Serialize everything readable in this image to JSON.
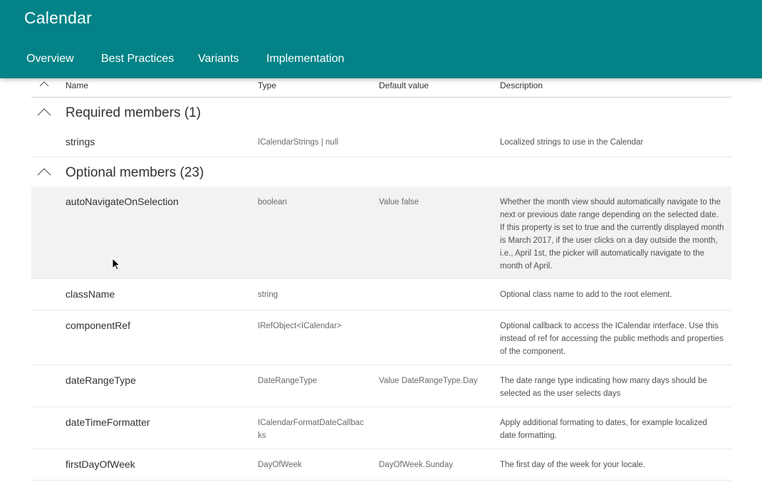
{
  "header": {
    "title": "Calendar",
    "tabs": [
      "Overview",
      "Best Practices",
      "Variants",
      "Implementation"
    ],
    "background": "#038387"
  },
  "table": {
    "columns": [
      "Name",
      "Type",
      "Default value",
      "Description"
    ],
    "groups": [
      {
        "title": "Required members (1)",
        "rows": [
          {
            "name": "strings",
            "type": "ICalendarStrings | null",
            "default": "",
            "description": "Localized strings to use in the Calendar"
          }
        ]
      },
      {
        "title": "Optional members (23)",
        "rows": [
          {
            "name": "autoNavigateOnSelection",
            "type": "boolean",
            "default": "Value false",
            "description": "Whether the month view should automatically navigate to the next or previous date range depending on the selected date. If this property is set to true and the currently displayed month is March 2017, if the user clicks on a day outside the month, i.e., April 1st, the picker will automatically navigate to the month of April."
          },
          {
            "name": "className",
            "type": "string",
            "default": "",
            "description": "Optional class name to add to the root element."
          },
          {
            "name": "componentRef",
            "type": "IRefObject<ICalendar>",
            "default": "",
            "description": "Optional callback to access the ICalendar interface. Use this instead of ref for accessing the public methods and properties of the component."
          },
          {
            "name": "dateRangeType",
            "type": "DateRangeType",
            "default": "Value DateRangeType.Day",
            "description": "The date range type indicating how many days should be selected as the user selects days"
          },
          {
            "name": "dateTimeFormatter",
            "type": "ICalendarFormatDateCallbacks",
            "default": "",
            "description": "Apply additional formating to dates, for example localized date formatting."
          },
          {
            "name": "firstDayOfWeek",
            "type": "DayOfWeek",
            "default": "DayOfWeek.Sunday",
            "description": "The first day of the week for your locale."
          }
        ]
      }
    ]
  }
}
